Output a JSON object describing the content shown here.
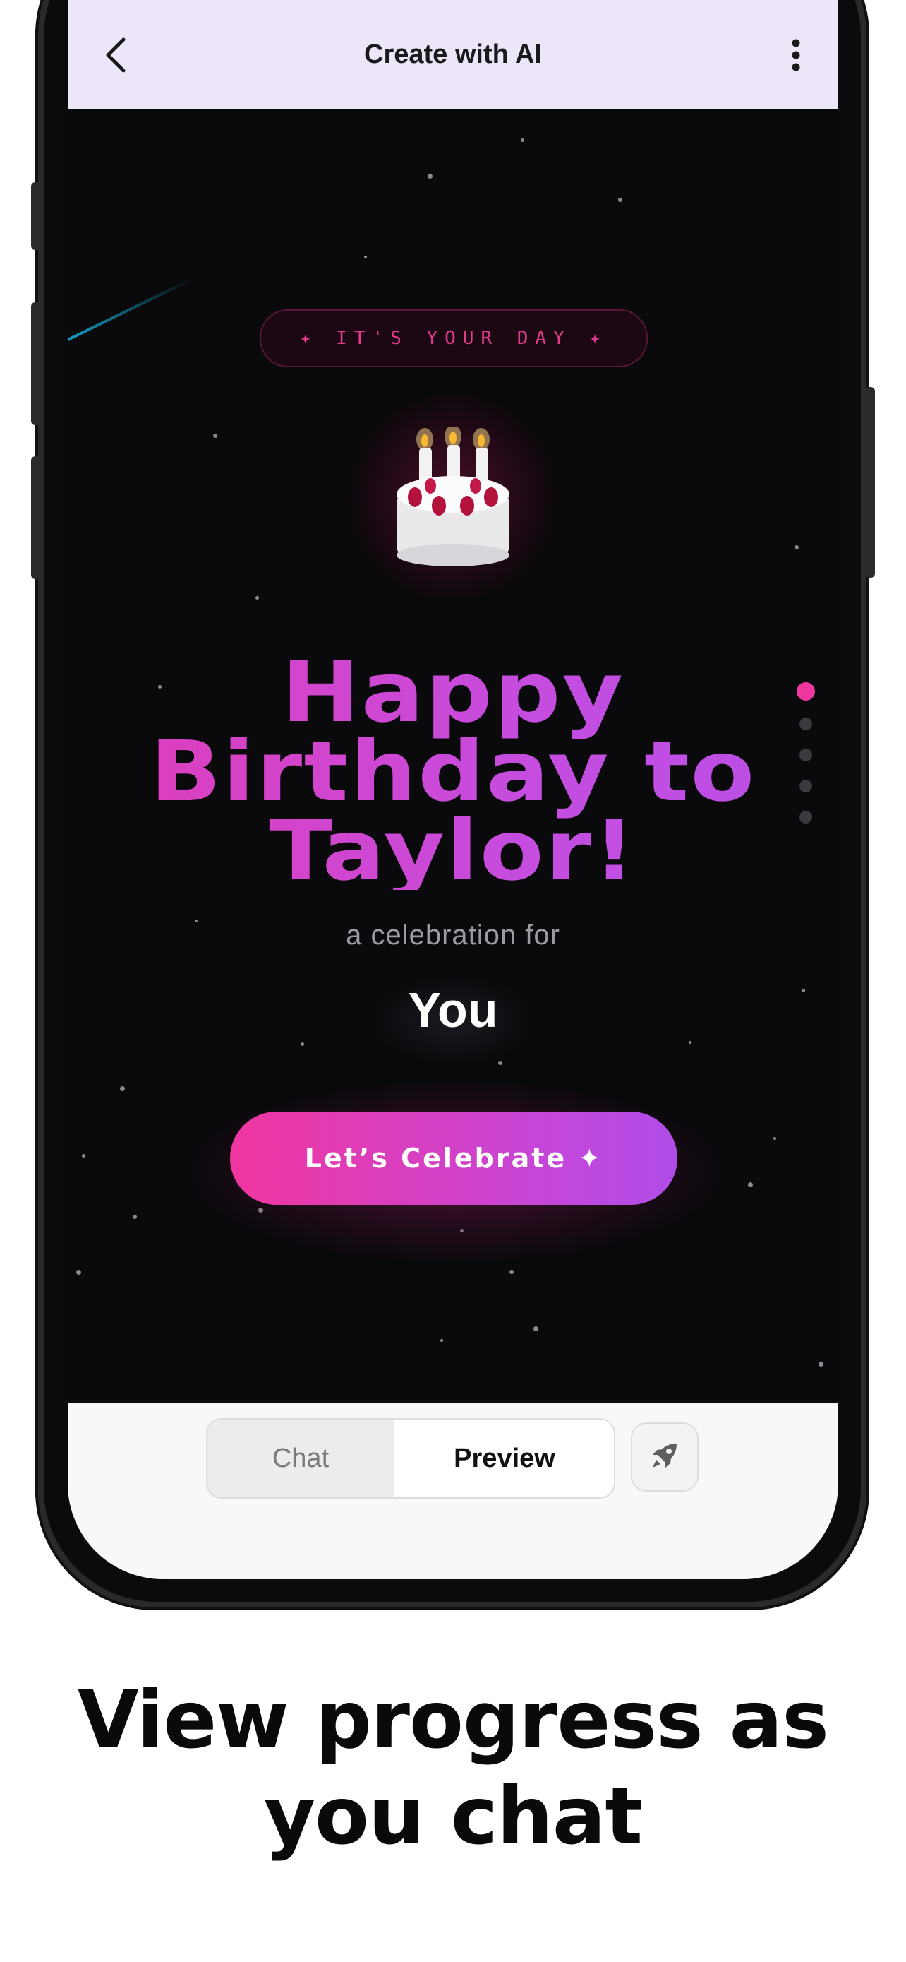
{
  "header": {
    "title": "Create with AI"
  },
  "preview": {
    "tag": "✦ IT'S YOUR DAY ✦",
    "cake_emoji": "cake-icon",
    "headline_lines": [
      "Happy",
      "Birthday to",
      "Taylor!"
    ],
    "subline": "a celebration for",
    "name": "You",
    "cta_label": "Let’s Celebrate ✦",
    "slide_count": 5,
    "active_slide": 1
  },
  "bottom_bar": {
    "tabs": [
      {
        "label": "Chat",
        "selected": false
      },
      {
        "label": "Preview",
        "selected": true
      }
    ],
    "action_icon": "rocket-icon"
  },
  "caption": {
    "line1": "View progress as",
    "line2": "you chat"
  },
  "colors": {
    "header_bg": "#ece6f8",
    "accent_pink": "#f0369f",
    "accent_purple": "#b04de8",
    "content_bg": "#0a090c"
  }
}
